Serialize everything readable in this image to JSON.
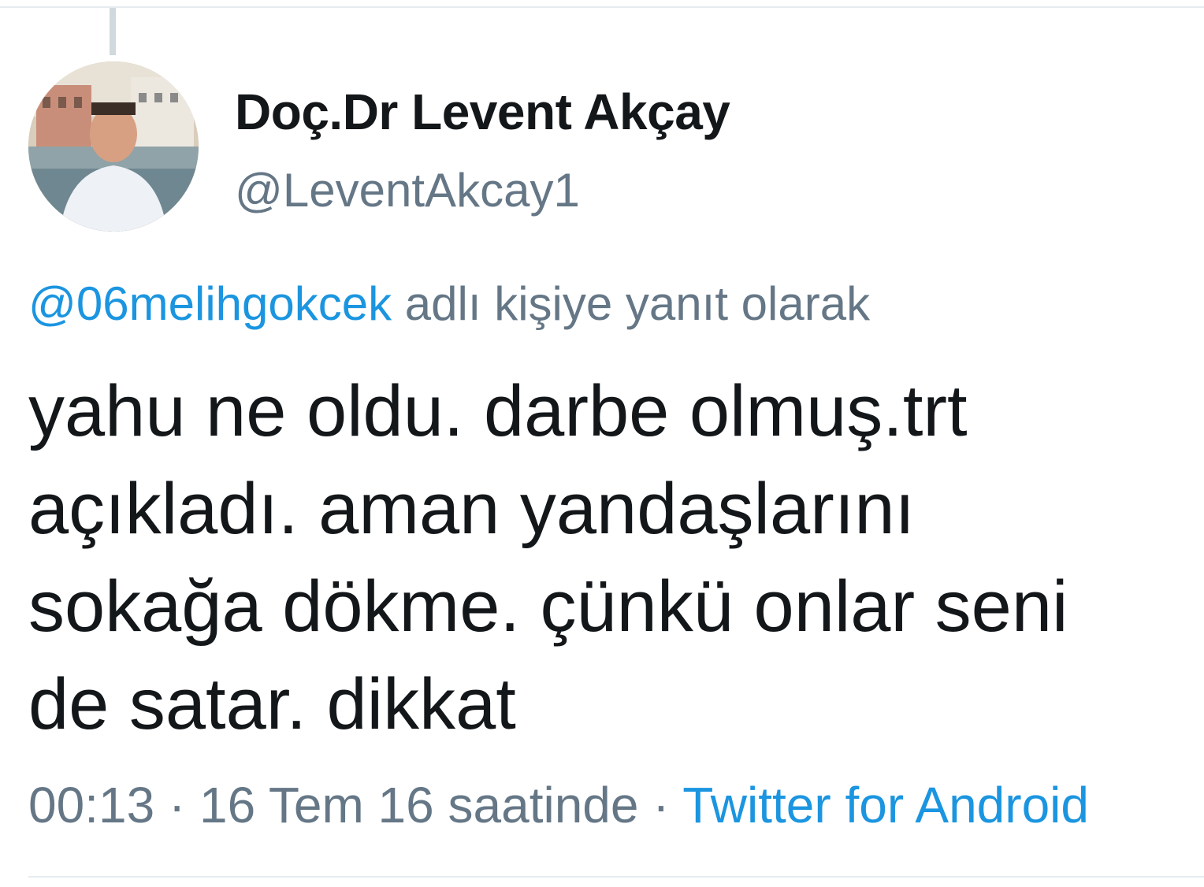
{
  "tweet": {
    "author": {
      "display_name": "Doç.Dr Levent Akçay",
      "handle": "@LeventAkcay1",
      "avatar_icon": "profile-photo"
    },
    "reply_context": {
      "mention": "@06melihgokcek",
      "suffix": " adlı kişiye yanıt olarak"
    },
    "text_lines": [
      "yahu ne oldu. darbe olmuş.trt",
      "açıkladı. aman yandaşlarını",
      "sokağa dökme. çünkü onlar seni",
      "de satar. dikkat"
    ],
    "meta": {
      "time": "00:13",
      "separator1": " · ",
      "date": "16 Tem 16 saatinde",
      "separator2": " · ",
      "source": "Twitter for Android"
    }
  },
  "colors": {
    "text_primary": "#14171a",
    "text_secondary": "#657786",
    "link": "#1b95e0",
    "divider": "#e6ecf0"
  }
}
